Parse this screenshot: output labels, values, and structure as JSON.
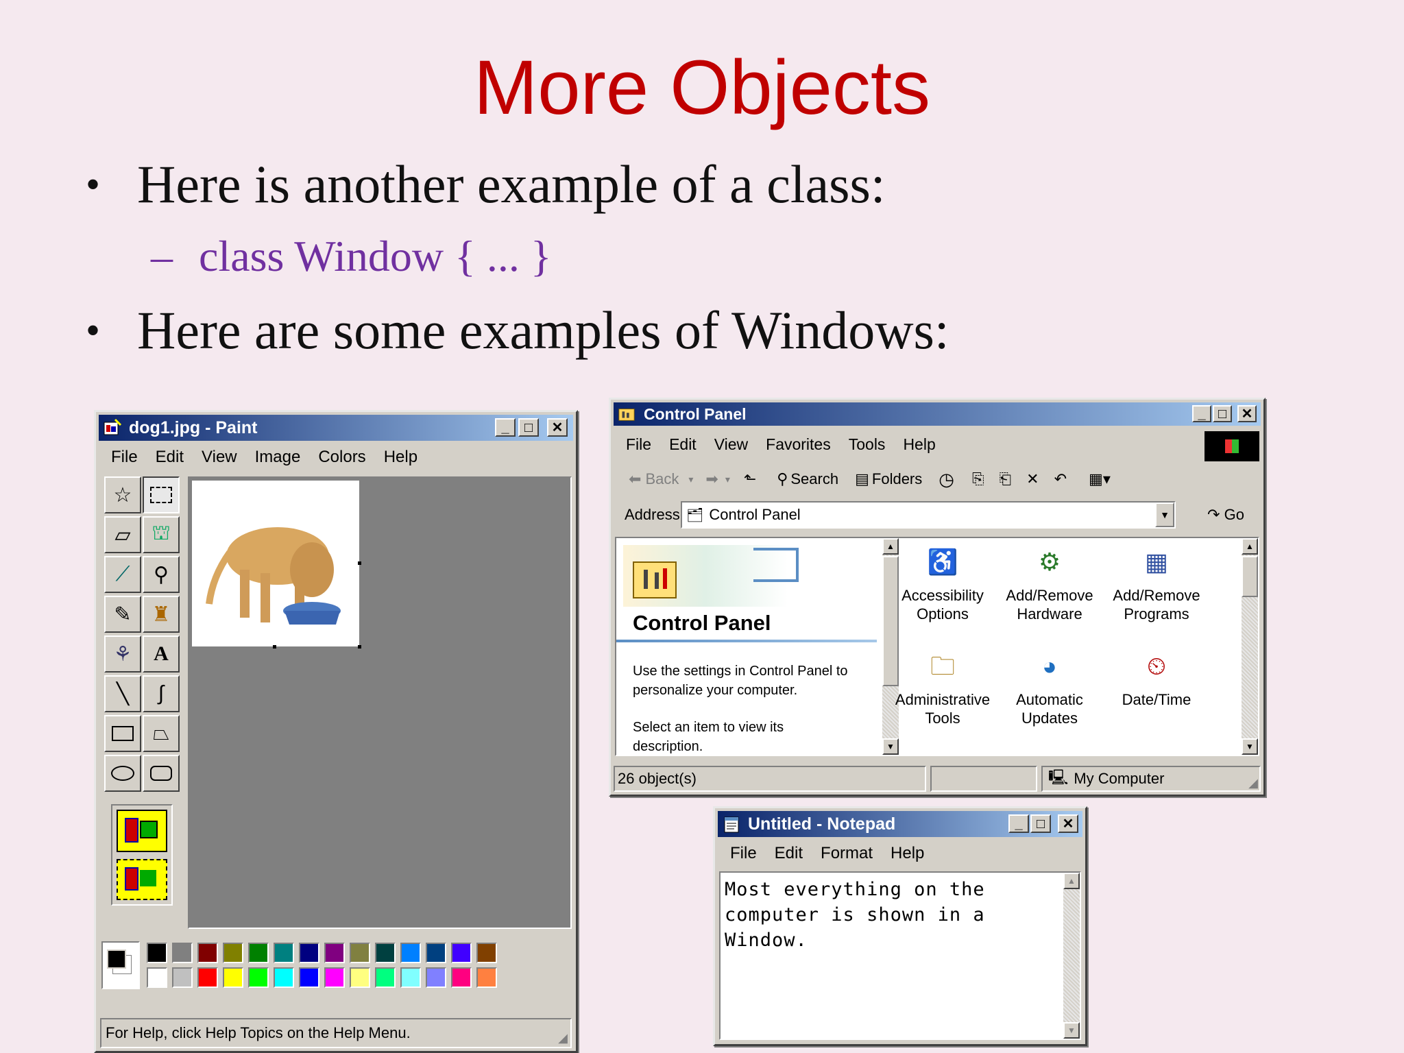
{
  "slide": {
    "title": "More Objects",
    "bullet1": "Here is another example of a class:",
    "sub1": "class Window { ... }",
    "bullet2": "Here are some examples of Windows:",
    "bullet_char": "•",
    "dash_char": "–"
  },
  "paint": {
    "title": "dog1.jpg - Paint",
    "menu": [
      "File",
      "Edit",
      "View",
      "Image",
      "Colors",
      "Help"
    ],
    "status": "For Help, click Help Topics on the Help Menu.",
    "palette_top": [
      "#000000",
      "#808080",
      "#800000",
      "#808000",
      "#008000",
      "#008080",
      "#000080",
      "#800080",
      "#808040",
      "#004040",
      "#0080ff",
      "#004080",
      "#4000ff",
      "#804000"
    ],
    "palette_bottom": [
      "#ffffff",
      "#c0c0c0",
      "#ff0000",
      "#ffff00",
      "#00ff00",
      "#00ffff",
      "#0000ff",
      "#ff00ff",
      "#ffff80",
      "#00ff80",
      "#80ffff",
      "#8080ff",
      "#ff0080",
      "#ff8040"
    ]
  },
  "control_panel": {
    "title": "Control Panel",
    "menu": [
      "File",
      "Edit",
      "View",
      "Favorites",
      "Tools",
      "Help"
    ],
    "toolbar": {
      "back": "Back",
      "search": "Search",
      "folders": "Folders"
    },
    "address_label": "Address",
    "address_value": "Control Panel",
    "go_label": "Go",
    "panel_heading": "Control Panel",
    "panel_text1": "Use the settings in Control Panel to personalize your computer.",
    "panel_text2": "Select an item to view its description.",
    "items": [
      {
        "label1": "Accessibility",
        "label2": "Options",
        "icon": "accessibility-icon"
      },
      {
        "label1": "Add/Remove",
        "label2": "Hardware",
        "icon": "hardware-icon"
      },
      {
        "label1": "Add/Remove",
        "label2": "Programs",
        "icon": "programs-icon"
      },
      {
        "label1": "Administrative",
        "label2": "Tools",
        "icon": "tools-folder-icon"
      },
      {
        "label1": "Automatic",
        "label2": "Updates",
        "icon": "globe-icon"
      },
      {
        "label1": "Date/Time",
        "label2": "",
        "icon": "calendar-clock-icon"
      }
    ],
    "status_count": "26 object(s)",
    "status_zone": "My Computer"
  },
  "notepad": {
    "title": "Untitled - Notepad",
    "menu": [
      "File",
      "Edit",
      "Format",
      "Help"
    ],
    "text_line1": "Most everything on the",
    "text_line2": "computer is shown in a",
    "text_line3": "Window."
  }
}
